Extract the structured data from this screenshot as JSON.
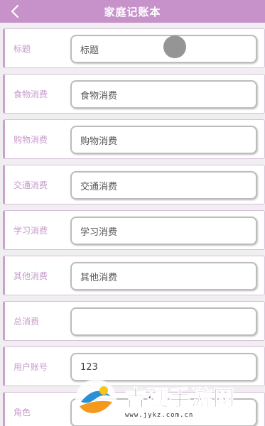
{
  "header": {
    "title": "家庭记账本",
    "back_icon": "chevron-left-icon"
  },
  "form": {
    "rows": [
      {
        "label": "标题",
        "value": "",
        "placeholder": "标题"
      },
      {
        "label": "食物消费",
        "value": "",
        "placeholder": "食物消费"
      },
      {
        "label": "购物消费",
        "value": "",
        "placeholder": "购物消费"
      },
      {
        "label": "交通消费",
        "value": "",
        "placeholder": "交通消费"
      },
      {
        "label": "学习消费",
        "value": "",
        "placeholder": "学习消费"
      },
      {
        "label": "其他消费",
        "value": "",
        "placeholder": "其他消费"
      },
      {
        "label": "总消费",
        "value": "",
        "placeholder": ""
      },
      {
        "label": "用户账号",
        "value": "123",
        "placeholder": ""
      },
      {
        "label": "角色",
        "value": "",
        "placeholder": ""
      }
    ]
  },
  "watermark": {
    "brand": "吉硬手游网",
    "url": "www.jykz.com.cn"
  },
  "colors": {
    "header": "#c692c9",
    "label": "#c79bca",
    "row_border": "#c9a2cc",
    "background": "#f0eef1"
  }
}
